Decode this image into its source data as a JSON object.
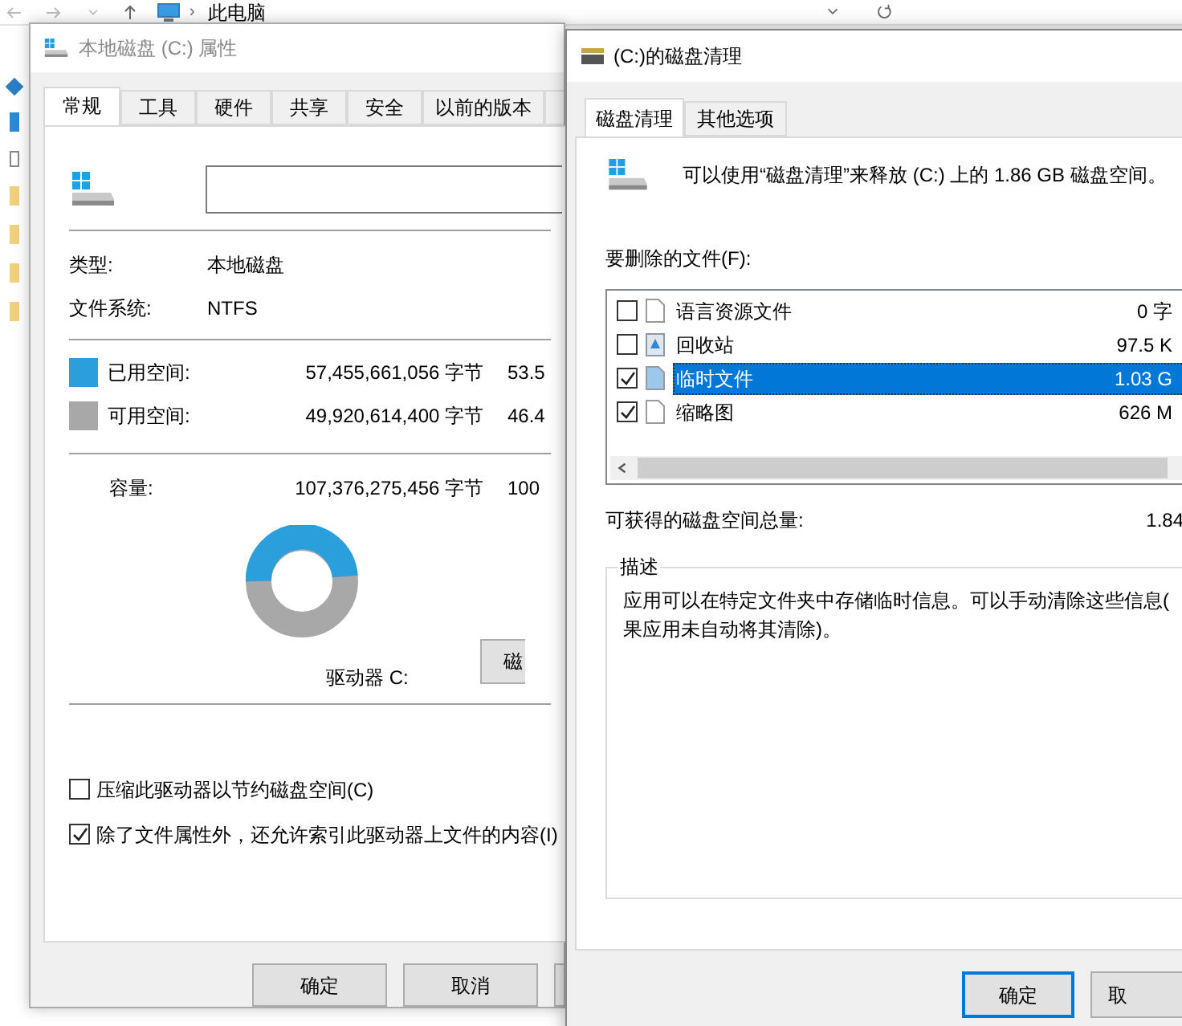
{
  "explorer": {
    "breadcrumb_separator": "›",
    "location": "此电脑"
  },
  "properties_window": {
    "title": "本地磁盘 (C:) 属性",
    "tabs": [
      {
        "label": "常规",
        "selected": true
      },
      {
        "label": "工具",
        "selected": false
      },
      {
        "label": "硬件",
        "selected": false
      },
      {
        "label": "共享",
        "selected": false
      },
      {
        "label": "安全",
        "selected": false
      },
      {
        "label": "以前的版本",
        "selected": false
      }
    ],
    "info": [
      {
        "label": "类型:",
        "value": "本地磁盘"
      },
      {
        "label": "文件系统:",
        "value": "NTFS"
      }
    ],
    "space": [
      {
        "label": "已用空间:",
        "bytes": "57,455,661,056 字节",
        "size": "53.5",
        "color": "#2a9fdc"
      },
      {
        "label": "可用空间:",
        "bytes": "49,920,614,400 字节",
        "size": "46.4",
        "color": "#a8a8a8"
      }
    ],
    "capacity": {
      "label": "容量:",
      "bytes": "107,376,275,456 字节",
      "size": "100"
    },
    "drive_label": "驱动器 C:",
    "cleanup_button": "磁",
    "options": [
      {
        "label": "压缩此驱动器以节约磁盘空间(C)",
        "checked": false
      },
      {
        "label": "除了文件属性外，还允许索引此驱动器上文件的内容(I)",
        "checked": true
      }
    ],
    "buttons": [
      "确定",
      "取消"
    ]
  },
  "cleanup_window": {
    "title": "(C:)的磁盘清理",
    "tabs": [
      {
        "label": "磁盘清理",
        "selected": true
      },
      {
        "label": "其他选项",
        "selected": false
      }
    ],
    "summary": "可以使用“磁盘清理”来释放  (C:) 上的 1.86 GB 磁盘空间。",
    "files_label": "要删除的文件(F):",
    "files": [
      {
        "name": "语言资源文件",
        "size": "0 字",
        "checked": false,
        "selected": false,
        "kind": "file"
      },
      {
        "name": "回收站",
        "size": "97.5 K",
        "checked": false,
        "selected": false,
        "kind": "recycle"
      },
      {
        "name": "临时文件",
        "size": "1.03 G",
        "checked": true,
        "selected": true,
        "kind": "file"
      },
      {
        "name": "缩略图",
        "size": "626 M",
        "checked": true,
        "selected": false,
        "kind": "file"
      }
    ],
    "total_label": "可获得的磁盘空间总量:",
    "total": "1.84",
    "description_title": "描述",
    "description_lines": [
      "应用可以在特定文件夹中存储临时信息。可以手动清除这些信息(",
      "果应用未自动将其清除)。"
    ],
    "buttons": [
      "确定",
      "取"
    ]
  }
}
